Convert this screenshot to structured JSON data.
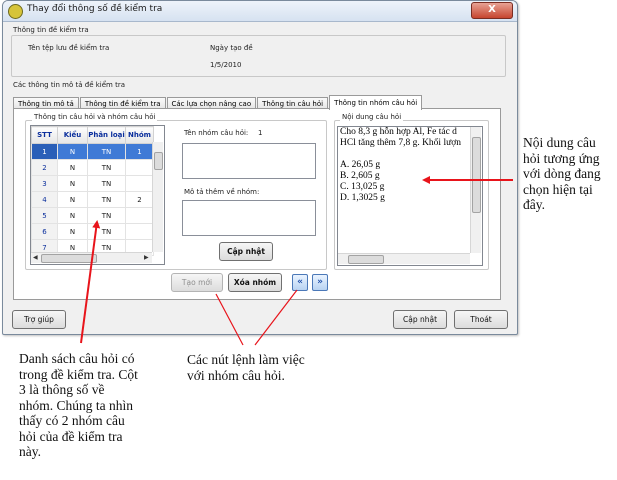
{
  "window": {
    "title": "Thay đổi thông số đề kiểm tra",
    "close_label": "X"
  },
  "test_info": {
    "group_title": "Thông tin đề kiểm tra",
    "file_name_label": "Tên tệp lưu đề kiểm tra",
    "date_label": "Ngày tạo đề",
    "date_value": "1/5/2010"
  },
  "description_group": {
    "title": "Các thông tin mô tả đề kiểm tra"
  },
  "tabs": [
    {
      "label": "Thông tin mô tả"
    },
    {
      "label": "Thông tin đề kiểm tra"
    },
    {
      "label": "Các lựa chọn nâng cao"
    },
    {
      "label": "Thông tin câu hỏi"
    },
    {
      "label": "Thông tin nhóm câu hỏi"
    }
  ],
  "question_group_panel": {
    "title": "Thông tin câu hỏi và nhóm câu hỏi",
    "columns": [
      "STT",
      "Kiểu",
      "Phân loại",
      "Nhóm"
    ],
    "rows": [
      {
        "stt": "1",
        "kieu": "N",
        "phan_loai": "TN",
        "nhom": "1"
      },
      {
        "stt": "2",
        "kieu": "N",
        "phan_loai": "TN",
        "nhom": ""
      },
      {
        "stt": "3",
        "kieu": "N",
        "phan_loai": "TN",
        "nhom": ""
      },
      {
        "stt": "4",
        "kieu": "N",
        "phan_loai": "TN",
        "nhom": "2"
      },
      {
        "stt": "5",
        "kieu": "N",
        "phan_loai": "TN",
        "nhom": ""
      },
      {
        "stt": "6",
        "kieu": "N",
        "phan_loai": "TN",
        "nhom": ""
      },
      {
        "stt": "7",
        "kieu": "N",
        "phan_loai": "TN",
        "nhom": ""
      }
    ],
    "group_name_label": "Tên nhóm câu hỏi:",
    "group_name_value": "1",
    "group_desc_label": "Mô tả thêm về nhóm:",
    "update_group_button": "Cập nhật"
  },
  "question_content": {
    "title": "Nội dung câu hỏi",
    "lines": [
      "Cho 8,3 g hỗn hợp Al, Fe tác d",
      "HCl tăng thêm 7,8 g. Khối lượn",
      "",
      "A.  26,05 g",
      "B.  2,605 g",
      "C.  13,025 g",
      "D.  1,3025 g"
    ]
  },
  "group_actions": {
    "new_button": "Tạo mới",
    "delete_button": "Xóa nhóm",
    "move_up_icon": "double-chevron-up-icon",
    "move_down_icon": "double-chevron-down-icon"
  },
  "footer": {
    "help_button": "Trợ giúp",
    "update_button": "Cập nhật",
    "exit_button": "Thoát"
  },
  "annotations": {
    "content_note": [
      "Nội dung câu",
      "hỏi tương ứng",
      "với dòng đang",
      "chọn hiện tại",
      "đây."
    ],
    "buttons_note": [
      "Các nút lệnh làm việc",
      "với nhóm câu hỏi."
    ],
    "list_note": [
      "Danh sách câu hỏi có",
      "trong đề kiểm tra. Cột",
      "3 là thông số về",
      "nhóm. Chúng ta nhìn",
      "thấy có 2 nhóm câu",
      "hỏi của đề kiểm tra",
      "này."
    ]
  },
  "colors": {
    "annotation_arrow": "#e8141b",
    "selected_row": "#3f7ad6",
    "header_text": "#0a2e9c"
  }
}
